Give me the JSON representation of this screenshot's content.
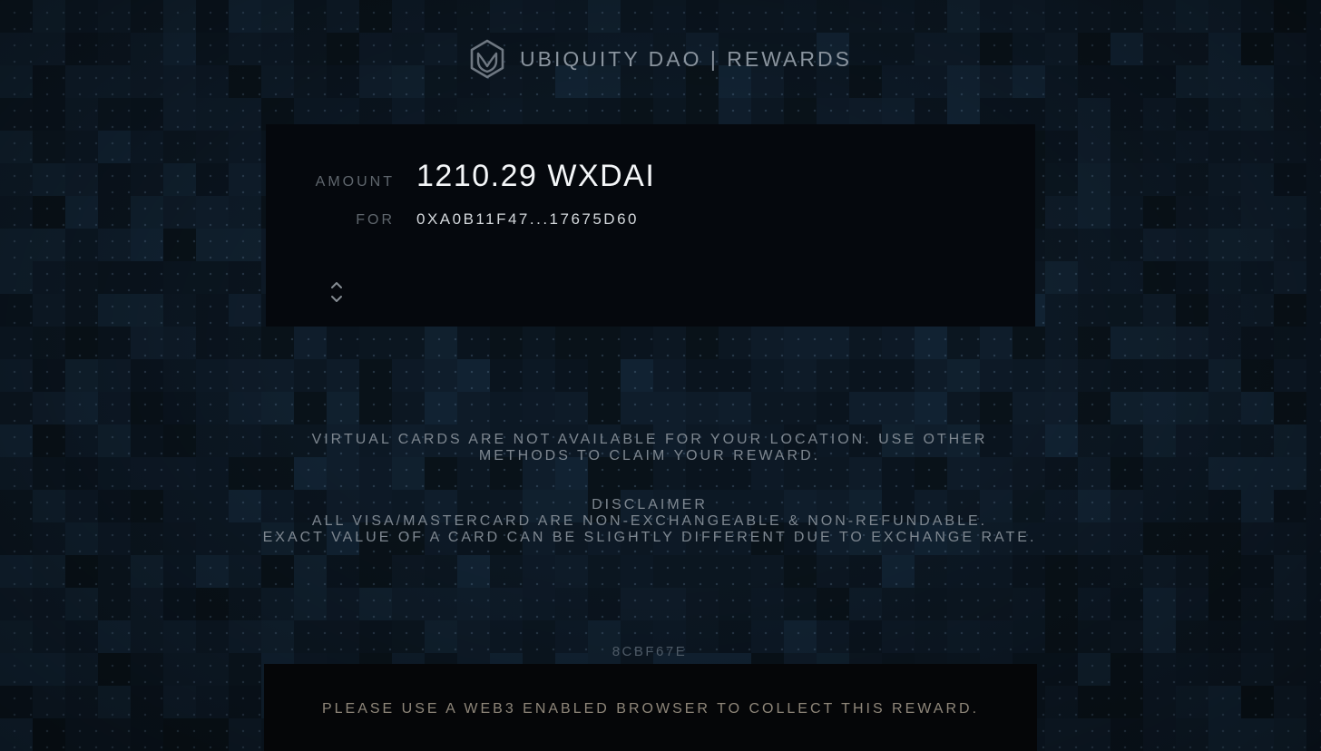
{
  "app": {
    "title": "UBIQUITY DAO | REWARDS",
    "logo_icon": "ubiquity-hexagon-logo-icon"
  },
  "reward": {
    "amount_label": "AMOUNT",
    "amount_value": "1210.29 WXDAI",
    "for_label": "FOR",
    "address_value": "0XA0B11F47...17675D60",
    "toggle_icon": "chevron-up-down-icon"
  },
  "notice": {
    "line1": "VIRTUAL CARDS ARE NOT AVAILABLE FOR YOUR LOCATION. USE OTHER",
    "line2": "METHODS TO CLAIM YOUR REWARD."
  },
  "disclaimer": {
    "heading": "DISCLAIMER",
    "line1": "ALL VISA/MASTERCARD ARE NON-EXCHANGEABLE & NON-REFUNDABLE.",
    "line2": "EXACT VALUE OF A CARD CAN BE SLIGHTLY DIFFERENT DUE TO EXCHANGE RATE."
  },
  "build_hash": "8CBF67E",
  "footer": {
    "message": "PLEASE USE A WEB3 ENABLED BROWSER TO COLLECT THIS REWARD."
  },
  "colors": {
    "background": "#0b1622",
    "card": "#05080d",
    "footer_bar": "#050608",
    "title": "#8a949e",
    "amount": "#f4f6f8",
    "muted_label": "#5f666d",
    "footer_text": "#8f877a"
  }
}
